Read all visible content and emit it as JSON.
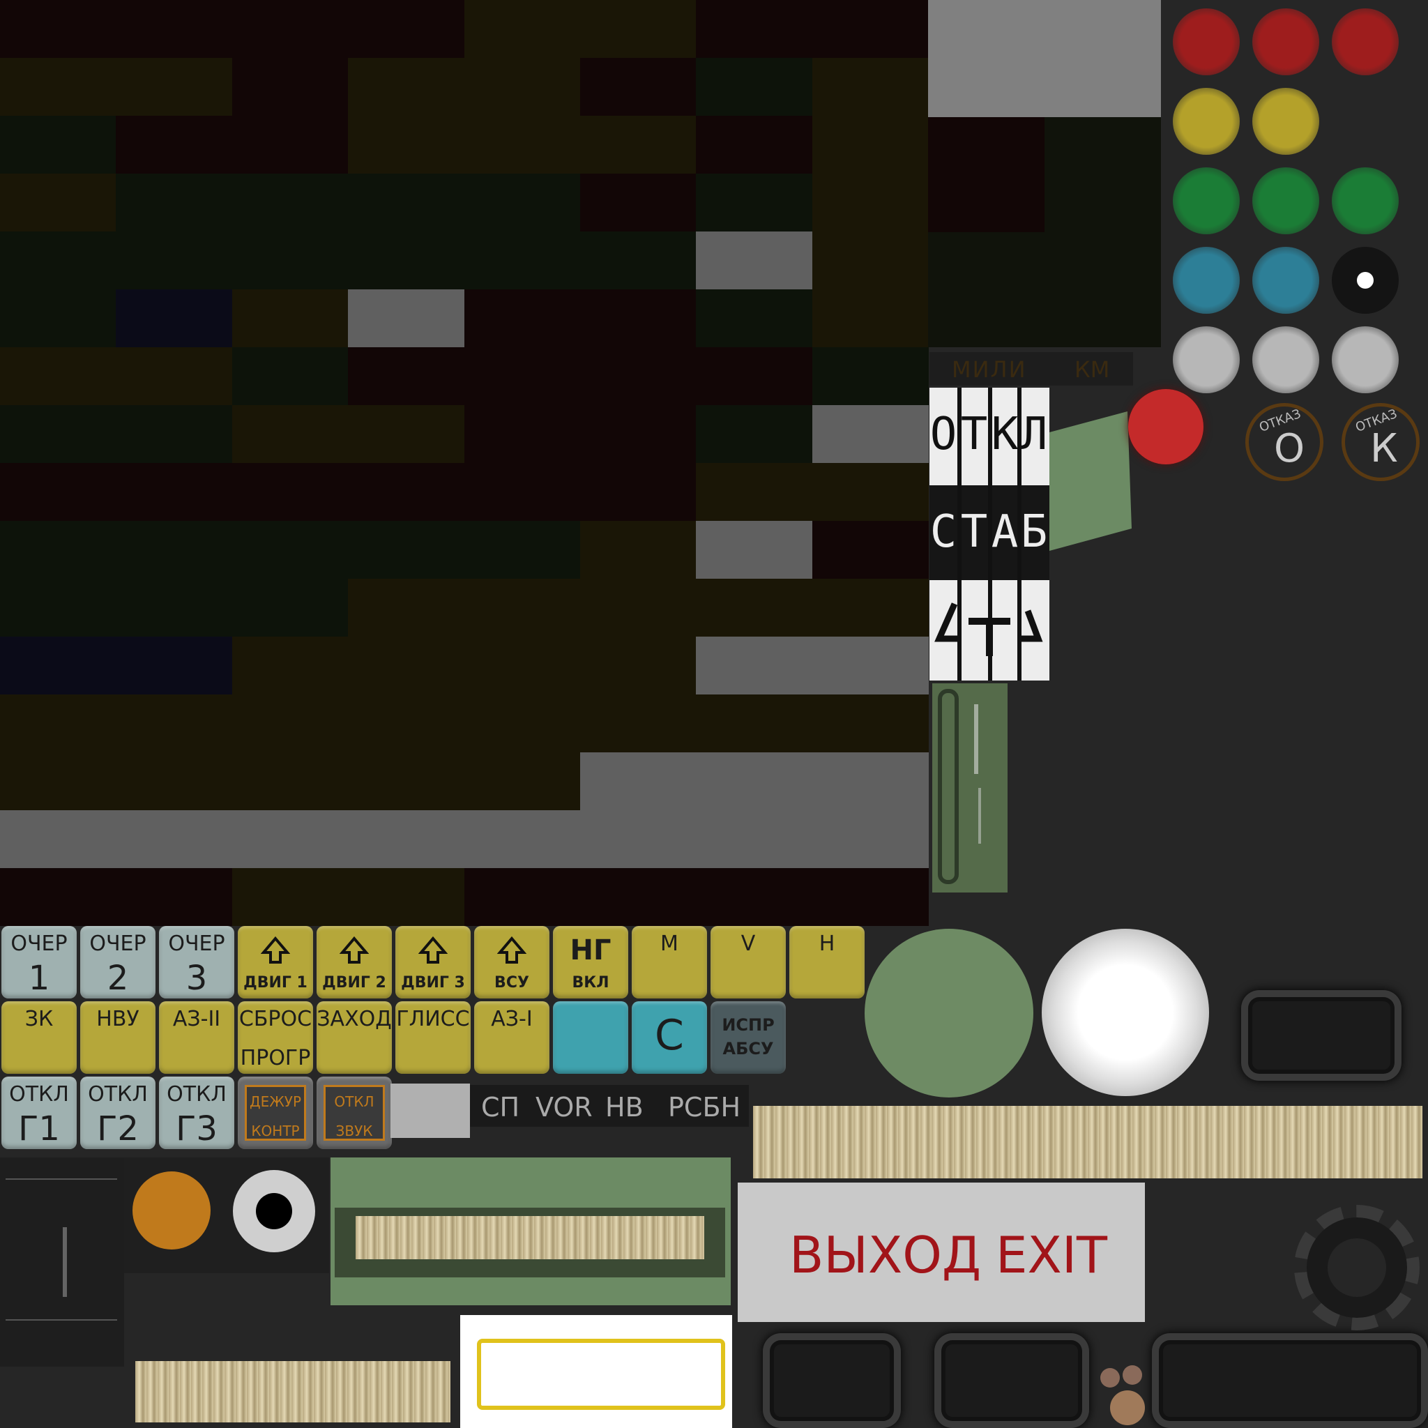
{
  "mosaic_colors": {
    "dark_red": "#120606",
    "dark_olive": "#1a1606",
    "dark_green": "#0d130a",
    "dark_navy": "#0b0b18",
    "mid_gray": "#606060",
    "light_gray": "#808080"
  },
  "lamps": {
    "red": "#9e1d1d",
    "yellow": "#b4a12a",
    "green": "#1b7d36",
    "blue": "#2d7f97",
    "white": "#b7b7b7",
    "black_dot": "#141414",
    "big_red": "#c42a2a"
  },
  "otkaz_dials": [
    {
      "arc": "ОТКАЗ",
      "letter": "О"
    },
    {
      "arc": "ОТКАЗ",
      "letter": "К"
    }
  ],
  "units_bar": {
    "left": "МИЛИ",
    "right": "КМ"
  },
  "mode_tape": {
    "row1": [
      "О",
      "Т",
      "К",
      "Л"
    ],
    "row2": [
      "С",
      "Т",
      "А",
      "Б"
    ]
  },
  "keypad": {
    "row1": [
      {
        "top": "ОЧЕР",
        "bottom": "1",
        "style": "gray"
      },
      {
        "top": "ОЧЕР",
        "bottom": "2",
        "style": "gray"
      },
      {
        "top": "ОЧЕР",
        "bottom": "3",
        "style": "gray"
      },
      {
        "label": "ДВИГ 1",
        "style": "yel",
        "icon": "up-arrow-icon"
      },
      {
        "label": "ДВИГ 2",
        "style": "yel",
        "icon": "up-arrow-icon"
      },
      {
        "label": "ДВИГ 3",
        "style": "yel",
        "icon": "up-arrow-icon"
      },
      {
        "label": "ВСУ",
        "style": "yel",
        "icon": "up-arrow-icon"
      },
      {
        "big": "НГ",
        "label": "ВКЛ",
        "style": "yel"
      },
      {
        "top": "М",
        "style": "yel"
      },
      {
        "top": "V",
        "style": "yel"
      },
      {
        "top": "Н",
        "style": "yel"
      }
    ],
    "row2": [
      {
        "top": "ЗК",
        "style": "yel"
      },
      {
        "top": "НВУ",
        "style": "yel"
      },
      {
        "top": "АЗ-II",
        "style": "yel"
      },
      {
        "top": "СБРОС",
        "bottom": "ПРОГР",
        "style": "yel"
      },
      {
        "top": "ЗАХОД",
        "style": "yel"
      },
      {
        "top": "ГЛИСС",
        "style": "yel"
      },
      {
        "top": "АЗ-I",
        "style": "yel"
      },
      {
        "style": "teal"
      },
      {
        "big": "С",
        "style": "teal"
      },
      {
        "top": "ИСПР",
        "bottom": "АБСУ",
        "style": "dark"
      }
    ],
    "row3": [
      {
        "top": "ОТКЛ",
        "bottom": "Г1",
        "style": "gray"
      },
      {
        "top": "ОТКЛ",
        "bottom": "Г2",
        "style": "gray"
      },
      {
        "top": "ОТКЛ",
        "bottom": "Г3",
        "style": "gray"
      },
      {
        "top": "ДЕЖУР",
        "bottom": "КОНТР",
        "style": "dark-box"
      },
      {
        "top": "ОТКЛ",
        "bottom": "ЗВУК",
        "style": "dark-box"
      }
    ]
  },
  "nav_strip": [
    "СП",
    "VOR",
    "НВ",
    "РСБН"
  ],
  "exit_sign": {
    "ru": "ВЫХОД",
    "en": "EXIT",
    "color": "#a11419"
  },
  "accent": {
    "orange": "#c07a1c",
    "sage": "#6e8a62",
    "yellow_frame": "#e0c21c"
  }
}
